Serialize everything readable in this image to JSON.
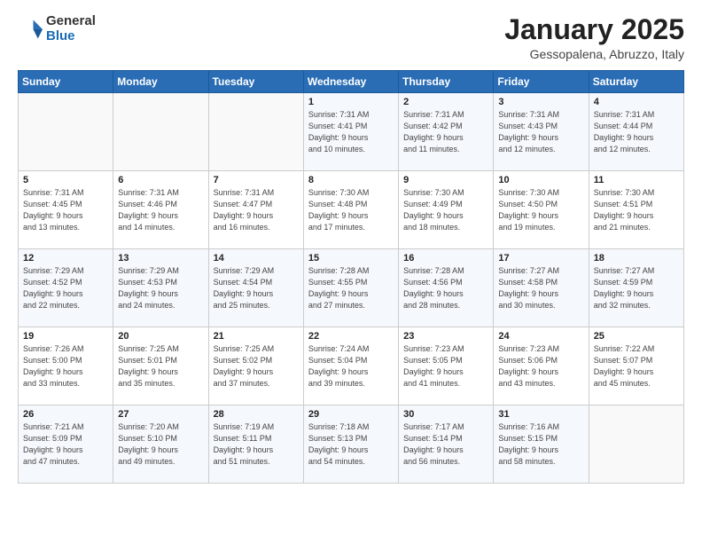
{
  "header": {
    "logo_general": "General",
    "logo_blue": "Blue",
    "month": "January 2025",
    "location": "Gessopalena, Abruzzo, Italy"
  },
  "weekdays": [
    "Sunday",
    "Monday",
    "Tuesday",
    "Wednesday",
    "Thursday",
    "Friday",
    "Saturday"
  ],
  "weeks": [
    [
      {
        "day": "",
        "info": ""
      },
      {
        "day": "",
        "info": ""
      },
      {
        "day": "",
        "info": ""
      },
      {
        "day": "1",
        "info": "Sunrise: 7:31 AM\nSunset: 4:41 PM\nDaylight: 9 hours\nand 10 minutes."
      },
      {
        "day": "2",
        "info": "Sunrise: 7:31 AM\nSunset: 4:42 PM\nDaylight: 9 hours\nand 11 minutes."
      },
      {
        "day": "3",
        "info": "Sunrise: 7:31 AM\nSunset: 4:43 PM\nDaylight: 9 hours\nand 12 minutes."
      },
      {
        "day": "4",
        "info": "Sunrise: 7:31 AM\nSunset: 4:44 PM\nDaylight: 9 hours\nand 12 minutes."
      }
    ],
    [
      {
        "day": "5",
        "info": "Sunrise: 7:31 AM\nSunset: 4:45 PM\nDaylight: 9 hours\nand 13 minutes."
      },
      {
        "day": "6",
        "info": "Sunrise: 7:31 AM\nSunset: 4:46 PM\nDaylight: 9 hours\nand 14 minutes."
      },
      {
        "day": "7",
        "info": "Sunrise: 7:31 AM\nSunset: 4:47 PM\nDaylight: 9 hours\nand 16 minutes."
      },
      {
        "day": "8",
        "info": "Sunrise: 7:30 AM\nSunset: 4:48 PM\nDaylight: 9 hours\nand 17 minutes."
      },
      {
        "day": "9",
        "info": "Sunrise: 7:30 AM\nSunset: 4:49 PM\nDaylight: 9 hours\nand 18 minutes."
      },
      {
        "day": "10",
        "info": "Sunrise: 7:30 AM\nSunset: 4:50 PM\nDaylight: 9 hours\nand 19 minutes."
      },
      {
        "day": "11",
        "info": "Sunrise: 7:30 AM\nSunset: 4:51 PM\nDaylight: 9 hours\nand 21 minutes."
      }
    ],
    [
      {
        "day": "12",
        "info": "Sunrise: 7:29 AM\nSunset: 4:52 PM\nDaylight: 9 hours\nand 22 minutes."
      },
      {
        "day": "13",
        "info": "Sunrise: 7:29 AM\nSunset: 4:53 PM\nDaylight: 9 hours\nand 24 minutes."
      },
      {
        "day": "14",
        "info": "Sunrise: 7:29 AM\nSunset: 4:54 PM\nDaylight: 9 hours\nand 25 minutes."
      },
      {
        "day": "15",
        "info": "Sunrise: 7:28 AM\nSunset: 4:55 PM\nDaylight: 9 hours\nand 27 minutes."
      },
      {
        "day": "16",
        "info": "Sunrise: 7:28 AM\nSunset: 4:56 PM\nDaylight: 9 hours\nand 28 minutes."
      },
      {
        "day": "17",
        "info": "Sunrise: 7:27 AM\nSunset: 4:58 PM\nDaylight: 9 hours\nand 30 minutes."
      },
      {
        "day": "18",
        "info": "Sunrise: 7:27 AM\nSunset: 4:59 PM\nDaylight: 9 hours\nand 32 minutes."
      }
    ],
    [
      {
        "day": "19",
        "info": "Sunrise: 7:26 AM\nSunset: 5:00 PM\nDaylight: 9 hours\nand 33 minutes."
      },
      {
        "day": "20",
        "info": "Sunrise: 7:25 AM\nSunset: 5:01 PM\nDaylight: 9 hours\nand 35 minutes."
      },
      {
        "day": "21",
        "info": "Sunrise: 7:25 AM\nSunset: 5:02 PM\nDaylight: 9 hours\nand 37 minutes."
      },
      {
        "day": "22",
        "info": "Sunrise: 7:24 AM\nSunset: 5:04 PM\nDaylight: 9 hours\nand 39 minutes."
      },
      {
        "day": "23",
        "info": "Sunrise: 7:23 AM\nSunset: 5:05 PM\nDaylight: 9 hours\nand 41 minutes."
      },
      {
        "day": "24",
        "info": "Sunrise: 7:23 AM\nSunset: 5:06 PM\nDaylight: 9 hours\nand 43 minutes."
      },
      {
        "day": "25",
        "info": "Sunrise: 7:22 AM\nSunset: 5:07 PM\nDaylight: 9 hours\nand 45 minutes."
      }
    ],
    [
      {
        "day": "26",
        "info": "Sunrise: 7:21 AM\nSunset: 5:09 PM\nDaylight: 9 hours\nand 47 minutes."
      },
      {
        "day": "27",
        "info": "Sunrise: 7:20 AM\nSunset: 5:10 PM\nDaylight: 9 hours\nand 49 minutes."
      },
      {
        "day": "28",
        "info": "Sunrise: 7:19 AM\nSunset: 5:11 PM\nDaylight: 9 hours\nand 51 minutes."
      },
      {
        "day": "29",
        "info": "Sunrise: 7:18 AM\nSunset: 5:13 PM\nDaylight: 9 hours\nand 54 minutes."
      },
      {
        "day": "30",
        "info": "Sunrise: 7:17 AM\nSunset: 5:14 PM\nDaylight: 9 hours\nand 56 minutes."
      },
      {
        "day": "31",
        "info": "Sunrise: 7:16 AM\nSunset: 5:15 PM\nDaylight: 9 hours\nand 58 minutes."
      },
      {
        "day": "",
        "info": ""
      }
    ]
  ]
}
